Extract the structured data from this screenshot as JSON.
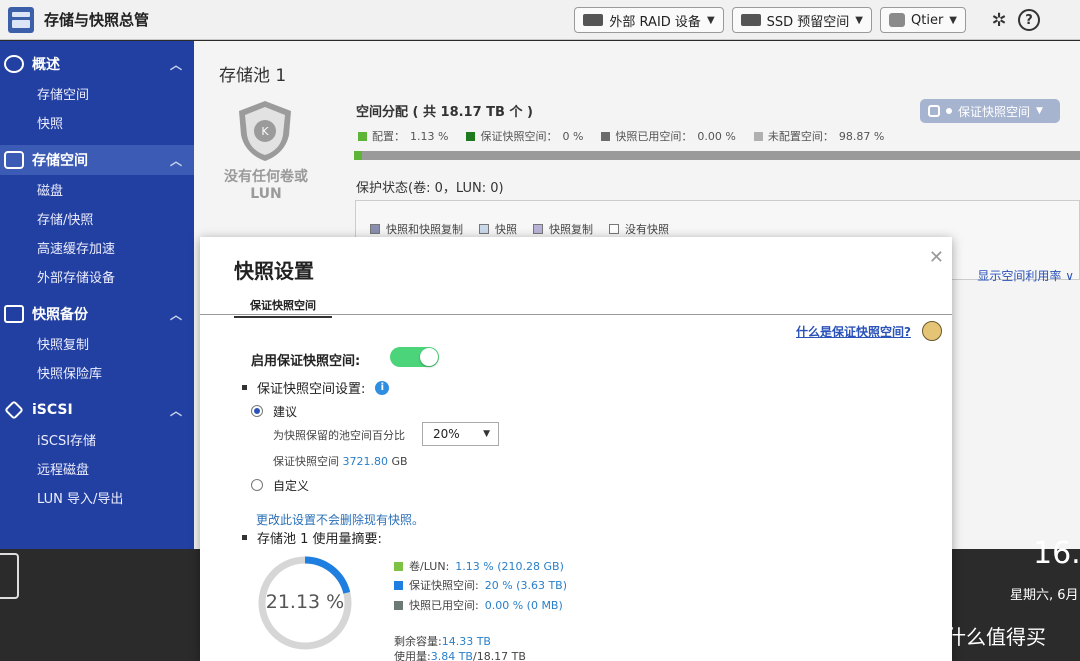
{
  "header": {
    "title": "存储与快照总管",
    "buttons": [
      {
        "label": "外部 RAID 设备",
        "icon": "raid-device-icon"
      },
      {
        "label": "SSD 预留空间",
        "icon": "ssd-icon"
      },
      {
        "label": "Qtier",
        "icon": "qtier-icon"
      }
    ]
  },
  "sidebar": {
    "sections": [
      {
        "label": "概述",
        "items": [
          "存储空间",
          "快照"
        ]
      },
      {
        "label": "存储空间",
        "items": [
          "磁盘",
          "存储/快照",
          "高速缓存加速",
          "外部存储设备"
        ]
      },
      {
        "label": "快照备份",
        "items": [
          "快照复制",
          "快照保险库"
        ]
      },
      {
        "label": "iSCSI",
        "items": [
          "iSCSI存储",
          "远程磁盘",
          "LUN 导入/导出"
        ]
      }
    ]
  },
  "main": {
    "pool_title": "存储池 1",
    "no_volume_text": "没有任何卷或 LUN",
    "space_title": "空间分配 ( 共 18.17 TB 个 )",
    "space_legend": [
      {
        "label": "配置：",
        "value": "1.13 %",
        "color": "#5cb536"
      },
      {
        "label": "保证快照空间：",
        "value": "0 %",
        "color": "#1f7a1f"
      },
      {
        "label": "快照已用空间：",
        "value": "0.00 %",
        "color": "#6b6b6b"
      },
      {
        "label": "未配置空间：",
        "value": "98.87 %",
        "color": "#b0b0b0"
      }
    ],
    "space_configured_fraction": 0.0113,
    "protect_title": "保护状态(卷: 0，LUN: 0)",
    "protect_legend": [
      "快照和快照复制",
      "快照",
      "快照复制",
      "没有快照"
    ],
    "guard_button": "保证快照空间",
    "show_util": "显示空间利用率"
  },
  "dialog": {
    "title": "快照设置",
    "tab": "保证快照空间",
    "what_link": "什么是保证快照空间?",
    "enable_label": "启用保证快照空间:",
    "enabled": true,
    "settings_heading": "保证快照空间设置:",
    "option_recommended": "建议",
    "percent_label": "为快照保留的池空间百分比",
    "percent_value": "20%",
    "guard_space_label": "保证快照空间",
    "guard_space_value": "3721.80",
    "guard_space_unit": "GB",
    "option_custom": "自定义",
    "note": "更改此设置不会删除现有快照。",
    "usage_heading": "存储池 1 使用量摘要:",
    "donut_value": "21.13 %",
    "donut_fraction": 0.2113,
    "usage_rows": [
      {
        "label": "卷/LUN:",
        "value": "1.13 % (210.28 GB)",
        "color": "#7dc242"
      },
      {
        "label": "保证快照空间:",
        "value": "20 % (3.63 TB)",
        "color": "#1e7fe0"
      },
      {
        "label": "快照已用空间:",
        "value": "0.00 % (0 MB)",
        "color": "#6b7a74"
      }
    ],
    "remaining_label": "剩余容量:",
    "remaining_value": "14.33 TB",
    "used_label": "使用量:",
    "used_value": "3.84 TB",
    "used_total": "/18.17 TB"
  },
  "desktop": {
    "clock": "16.",
    "weekday": "星期六, 6月",
    "watermark": "什么值得买",
    "watermark_icon": "值"
  }
}
